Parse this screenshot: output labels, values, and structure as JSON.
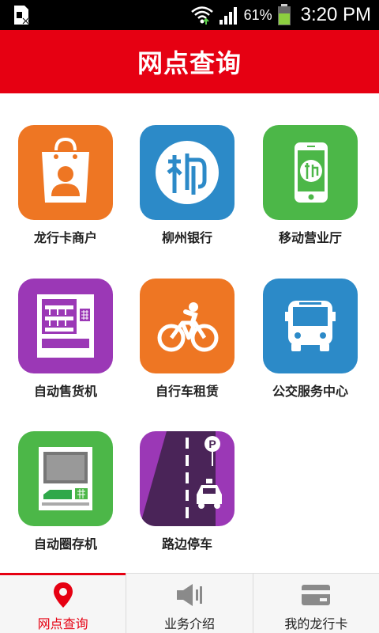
{
  "status_bar": {
    "battery_percent": "61%",
    "time": "3:20 PM",
    "icons": [
      "sim-card-icon",
      "wifi-icon",
      "signal-icon",
      "battery-icon"
    ]
  },
  "header": {
    "title": "网点查询"
  },
  "grid": {
    "items": [
      {
        "label": "龙行卡商户",
        "icon": "shopping-bag-icon",
        "color": "#ee7623"
      },
      {
        "label": "柳州银行",
        "icon": "bank-logo-icon",
        "color": "#2c8ac8"
      },
      {
        "label": "移动营业厅",
        "icon": "mobile-phone-icon",
        "color": "#4cb748"
      },
      {
        "label": "自动售货机",
        "icon": "vending-machine-icon",
        "color": "#9b38b6"
      },
      {
        "label": "自行车租赁",
        "icon": "bicycle-icon",
        "color": "#ee7623"
      },
      {
        "label": "公交服务中心",
        "icon": "bus-icon",
        "color": "#2c8ac8"
      },
      {
        "label": "自动圈存机",
        "icon": "atm-icon",
        "color": "#4cb748"
      },
      {
        "label": "路边停车",
        "icon": "parking-icon",
        "color": "#9b38b6"
      }
    ]
  },
  "tabs": [
    {
      "label": "网点查询",
      "icon": "location-pin-icon",
      "active": true
    },
    {
      "label": "业务介绍",
      "icon": "speaker-icon",
      "active": false
    },
    {
      "label": "我的龙行卡",
      "icon": "card-icon",
      "active": false
    }
  ],
  "colors": {
    "brand_red": "#e60012"
  }
}
